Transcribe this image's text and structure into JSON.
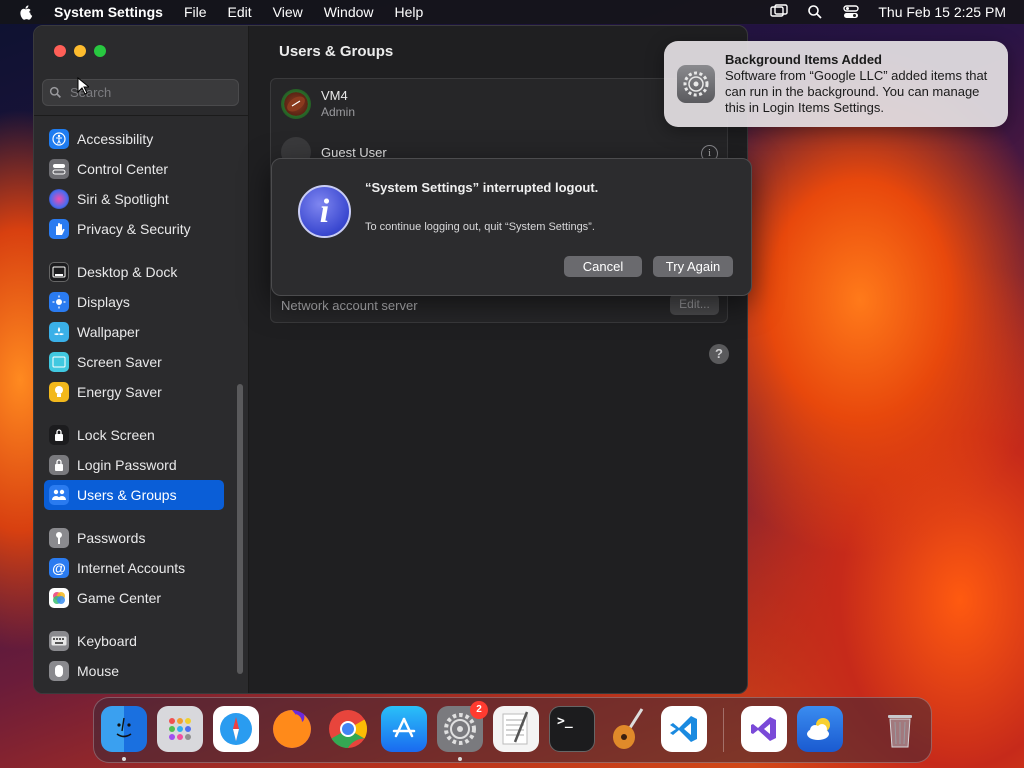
{
  "menubar": {
    "app_name": "System Settings",
    "items": [
      "File",
      "Edit",
      "View",
      "Window",
      "Help"
    ],
    "clock": "Thu Feb 15  2:25 PM"
  },
  "window": {
    "title": "Users & Groups",
    "search": {
      "placeholder": "Search"
    },
    "sidebar": {
      "items": [
        "Accessibility",
        "Control Center",
        "Siri & Spotlight",
        "Privacy & Security",
        "Desktop & Dock",
        "Displays",
        "Wallpaper",
        "Screen Saver",
        "Energy Saver",
        "Lock Screen",
        "Login Password",
        "Users & Groups",
        "Passwords",
        "Internet Accounts",
        "Game Center",
        "Keyboard",
        "Mouse"
      ],
      "selected": "Users & Groups"
    },
    "users": [
      {
        "name": "VM4",
        "role": "Admin"
      },
      {
        "name": "Guest User",
        "role": ""
      }
    ],
    "network_label": "Network account server",
    "edit_label": "Edit...",
    "help_label": "?"
  },
  "alert": {
    "title": "“System Settings” interrupted logout.",
    "message": "To continue logging out, quit “System Settings”.",
    "cancel": "Cancel",
    "try_again": "Try Again"
  },
  "notification": {
    "title": "Background Items Added",
    "body": "Software from “Google LLC” added items that can run in the background. You can manage this in Login Items Settings."
  },
  "dock": {
    "settings_badge": "2",
    "terminal_prompt": ">_"
  },
  "colors": {
    "accent": "#0a5ed7",
    "window_bg": "#1f1f21",
    "sidebar_bg": "#2b2b2d",
    "badge": "#ff3b30"
  }
}
